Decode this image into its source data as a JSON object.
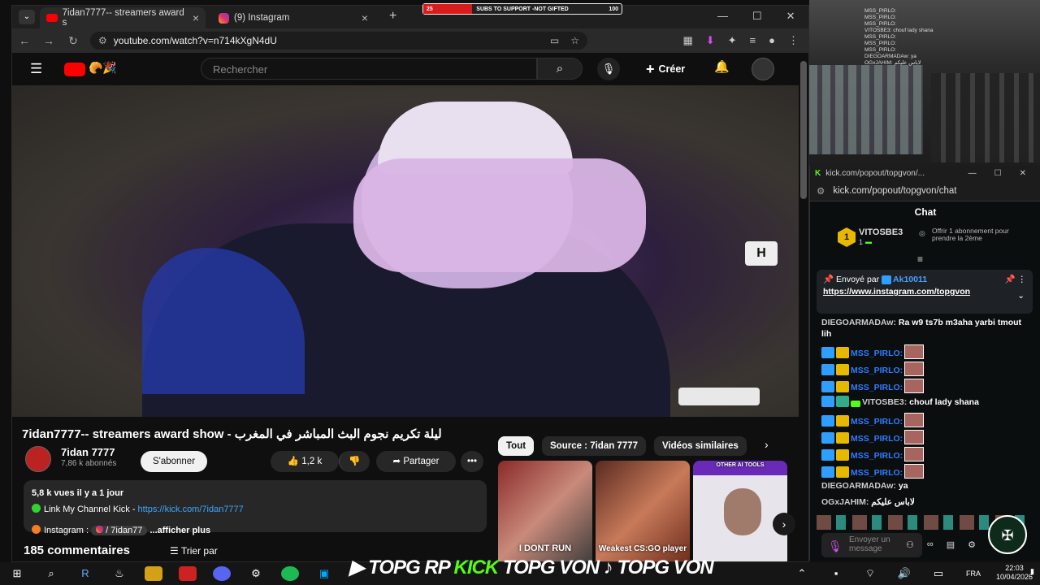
{
  "browser": {
    "tabs": [
      {
        "title": "7idan7777-- streamers award s",
        "active": true
      },
      {
        "title": "(9) Instagram",
        "active": false
      }
    ],
    "new_tab": "+",
    "url": "youtube.com/watch?v=n714kXgN4dU"
  },
  "youtube": {
    "search_placeholder": "Rechercher",
    "create_label": "Créer",
    "video_title": "7idan7777-- streamers award show - ليلة تكريم نجوم البث المباشر في المغرب",
    "overlay_letter": "H",
    "channel_name": "7idan 7777",
    "channel_subs": "7,86 k abonnés",
    "subscribe_label": "S'abonner",
    "likes": "1,2 k",
    "share_label": "Partager",
    "more_label": "•••",
    "description": {
      "meta": "5,8 k vues  il y a 1 jour",
      "line1_text": "Link My Channel Kick - ",
      "line1_link": "https://kick.com/7idan7777",
      "line2_text": "Instagram :",
      "line2_handle": "/ 7idan77",
      "line2_more": "...afficher plus"
    },
    "comments_count": "185 commentaires",
    "sort_label": "Trier par",
    "chips": [
      {
        "label": "Tout",
        "active": true
      },
      {
        "label": "Source : 7idan 7777",
        "active": false
      },
      {
        "label": "Vidéos similaires",
        "active": false
      }
    ],
    "thumbnails": [
      {
        "label": "I DONT RUN"
      },
      {
        "label": "Weakest CS:GO player"
      },
      {
        "label": "OTHER AI TOOLS"
      }
    ]
  },
  "stream_banner": {
    "left": "25",
    "text": "SUBS TO SUPPORT -NOT GIFTED",
    "right": "100"
  },
  "overlay_chat": [
    "MSS_PIRLO:",
    "MSS_PIRLO:",
    "MSS_PIRLO:",
    "VITOSBE3: chouf lady shana",
    "MSS_PIRLO:",
    "MSS_PIRLO:",
    "MSS_PIRLO:",
    "DIEGOARMADAw: ya",
    "OGxJAHIM: لاباس عليكم"
  ],
  "kick": {
    "window_title": "kick.com/popout/topgvon/...",
    "url": "kick.com/popout/topgvon/chat",
    "chat_title": "Chat",
    "leader": {
      "rank": "1",
      "name": "VITOSBE3",
      "count": "1",
      "gift_text": "Offrir 1 abonnement pour prendre la 2ème"
    },
    "pinned": {
      "sent_by": "Envoyé par",
      "user": "Ak10011",
      "link": "https://www.instagram.com/topgvon"
    },
    "messages": [
      {
        "user": "DIEGOARMADAw:",
        "text": "Ra w9 ts7b m3aha yarbi tmout lih"
      },
      {
        "user": "MSS_PIRLO:",
        "text": ""
      },
      {
        "user": "MSS_PIRLO:",
        "text": ""
      },
      {
        "user": "MSS_PIRLO:",
        "text": ""
      },
      {
        "user": "VITOSBE3:",
        "text": "chouf lady shana"
      },
      {
        "user": "MSS_PIRLO:",
        "text": ""
      },
      {
        "user": "MSS_PIRLO:",
        "text": ""
      },
      {
        "user": "MSS_PIRLO:",
        "text": ""
      },
      {
        "user": "MSS_PIRLO:",
        "text": ""
      },
      {
        "user": "DIEGOARMADAw:",
        "text": "ya"
      },
      {
        "user": "OGxJAHIM:",
        "text": "لاباس عليكم"
      }
    ],
    "input_placeholder": "Envoyer un message"
  },
  "stream_overlay": {
    "text1": "TOPG RP",
    "text2": "KICK",
    "text3": "TOPG VON",
    "text4": "TOPG VON"
  },
  "taskbar": {
    "lang": "FRA",
    "time": "22:03",
    "date": "10/04/2026"
  }
}
